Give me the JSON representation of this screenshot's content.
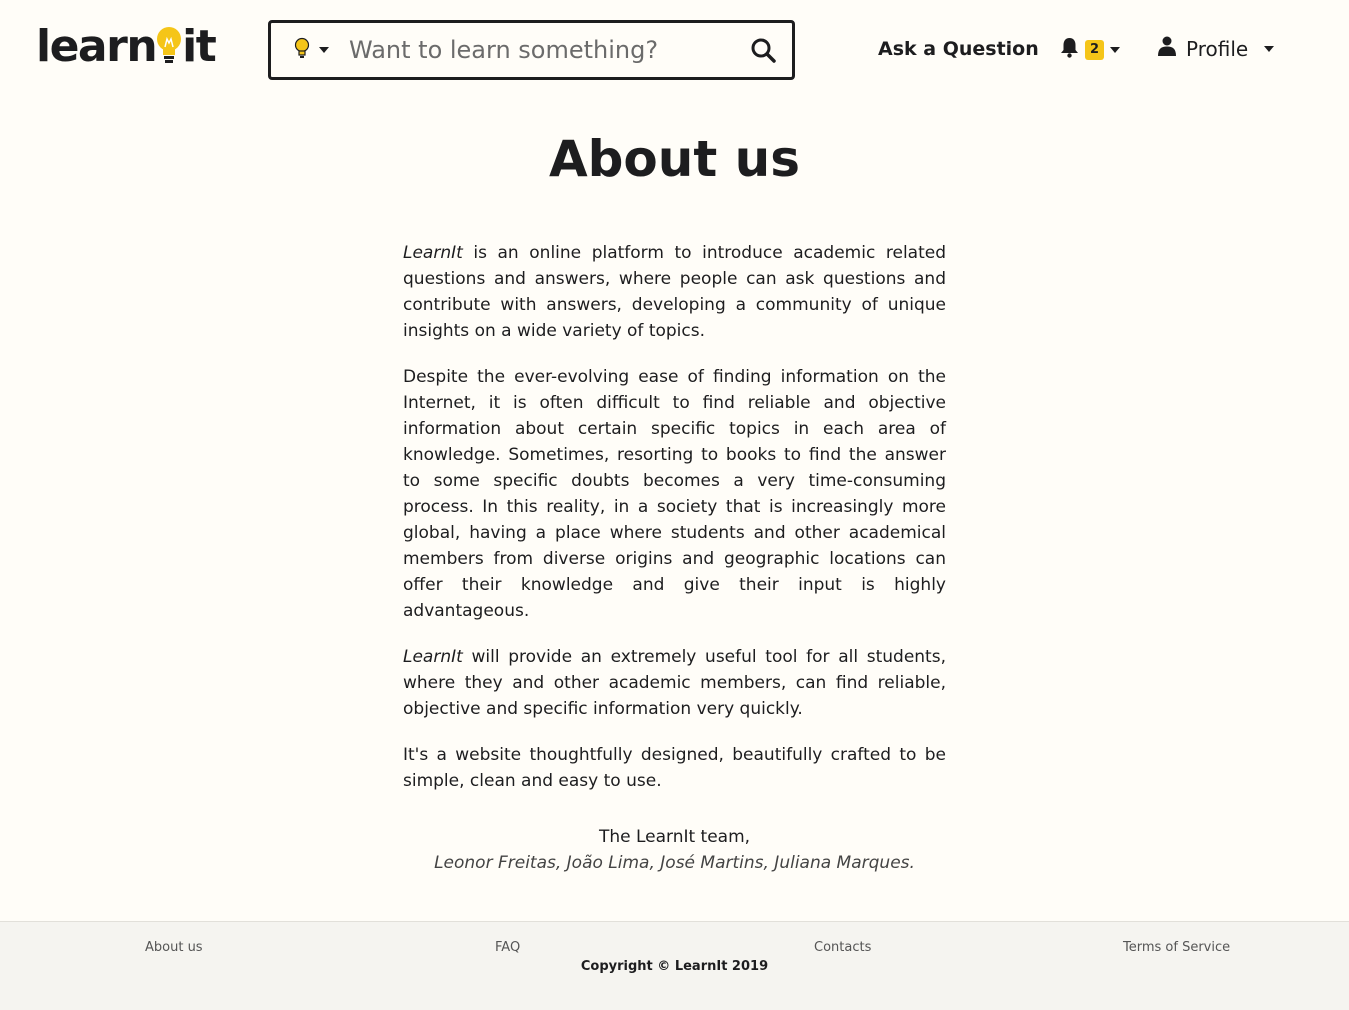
{
  "brand": {
    "logo_left": "learn",
    "logo_right": "it",
    "accent_color": "#f5c518",
    "text_color": "#1d1d1f"
  },
  "search": {
    "placeholder": "Want to learn something?",
    "category_icon": "lightbulb-icon",
    "search_icon": "search-icon"
  },
  "nav": {
    "ask_question": "Ask a Question",
    "notifications_count": "2",
    "profile_label": "Profile"
  },
  "page": {
    "title": "About us",
    "p1_brand": "LearnIt",
    "p1_rest": " is an online platform to introduce academic related questions and answers, where people can ask questions and contribute with answers, developing a community of unique insights on a wide variety of topics.",
    "p2": "Despite the ever-evolving ease of finding information on the Internet, it is often difficult to find reliable and objective information about certain specific topics in each area of knowledge. Sometimes, resorting to books to find the answer to some specific doubts becomes a very time-consuming process. In this reality, in a society that is increasingly more global, having a place where students and other academical members from diverse origins and geographic locations can offer their knowledge and give their input is highly advantageous.",
    "p3_brand": "LearnIt",
    "p3_rest": " will provide an extremely useful tool for all students, where they and other academic members, can find reliable, objective and specific information very quickly.",
    "p4": "It's a website thoughtfully designed, beautifully crafted to be simple, clean and easy to use.",
    "signature": "The LearnIt team,",
    "authors": "Leonor Freitas, João Lima, José Martins, Juliana Marques."
  },
  "footer": {
    "about": "About us",
    "faq": "FAQ",
    "contacts": "Contacts",
    "terms": "Terms of Service",
    "copyright": "Copyright © LearnIt 2019"
  }
}
